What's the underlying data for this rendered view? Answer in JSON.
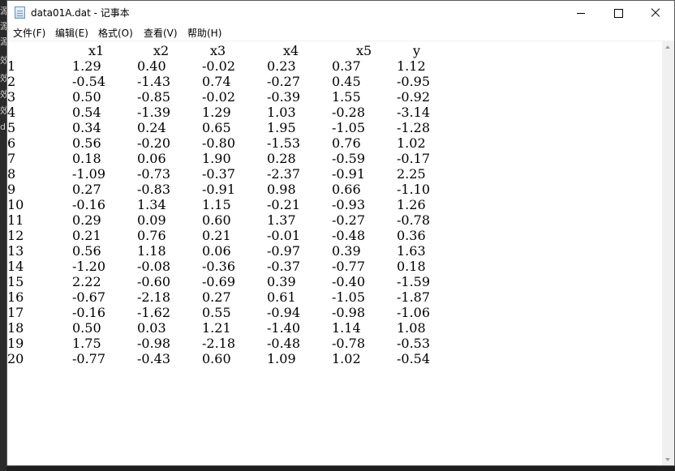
{
  "background_fragments": [
    "源",
    "源",
    "源",
    "效",
    "效",
    "效",
    "效",
    "d"
  ],
  "window": {
    "title": "data01A.dat - 记事本"
  },
  "menu": [
    {
      "label": "文件(F)",
      "name": "menu-file"
    },
    {
      "label": "编辑(E)",
      "name": "menu-edit"
    },
    {
      "label": "格式(O)",
      "name": "menu-format"
    },
    {
      "label": "查看(V)",
      "name": "menu-view"
    },
    {
      "label": "帮助(H)",
      "name": "menu-help"
    }
  ],
  "table": {
    "headers": [
      "x1",
      "x2",
      "x3",
      "x4",
      "x5",
      "y"
    ],
    "rows": [
      [
        "1",
        "1.29",
        "0.40",
        "-0.02",
        "0.23",
        "0.37",
        "1.12"
      ],
      [
        "2",
        "-0.54",
        "-1.43",
        "0.74",
        "-0.27",
        "0.45",
        "-0.95"
      ],
      [
        "3",
        "0.50",
        "-0.85",
        "-0.02",
        "-0.39",
        "1.55",
        "-0.92"
      ],
      [
        "4",
        "0.54",
        "-1.39",
        "1.29",
        "1.03",
        "-0.28",
        "-3.14"
      ],
      [
        "5",
        "0.34",
        "0.24",
        "0.65",
        "1.95",
        "-1.05",
        "-1.28"
      ],
      [
        "6",
        "0.56",
        "-0.20",
        "-0.80",
        "-1.53",
        "0.76",
        "1.02"
      ],
      [
        "7",
        "0.18",
        "0.06",
        "1.90",
        "0.28",
        "-0.59",
        "-0.17"
      ],
      [
        "8",
        "-1.09",
        "-0.73",
        "-0.37",
        "-2.37",
        "-0.91",
        "2.25"
      ],
      [
        "9",
        "0.27",
        "-0.83",
        "-0.91",
        "0.98",
        "0.66",
        "-1.10"
      ],
      [
        "10",
        "-0.16",
        "1.34",
        "1.15",
        "-0.21",
        "-0.93",
        "1.26"
      ],
      [
        "11",
        "0.29",
        "0.09",
        "0.60",
        "1.37",
        "-0.27",
        "-0.78"
      ],
      [
        "12",
        "0.21",
        "0.76",
        "0.21",
        "-0.01",
        "-0.48",
        "0.36"
      ],
      [
        "13",
        "0.56",
        "1.18",
        "0.06",
        "-0.97",
        "0.39",
        "1.63"
      ],
      [
        "14",
        "-1.20",
        "-0.08",
        "-0.36",
        "-0.37",
        "-0.77",
        "0.18"
      ],
      [
        "15",
        "2.22",
        "-0.60",
        "-0.69",
        "0.39",
        "-0.40",
        "-1.59"
      ],
      [
        "16",
        "-0.67",
        "-2.18",
        "0.27",
        "0.61",
        "-1.05",
        "-1.87"
      ],
      [
        "17",
        "-0.16",
        "-1.62",
        "0.55",
        "-0.94",
        "-0.98",
        "-1.06"
      ],
      [
        "18",
        "0.50",
        "0.03",
        "1.21",
        "-1.40",
        "1.14",
        "1.08"
      ],
      [
        "19",
        "1.75",
        "-0.98",
        "-2.18",
        "-0.48",
        "-0.78",
        "-0.53"
      ],
      [
        "20",
        "-0.77",
        "-0.43",
        "0.60",
        "1.09",
        "1.02",
        "-0.54"
      ]
    ]
  }
}
